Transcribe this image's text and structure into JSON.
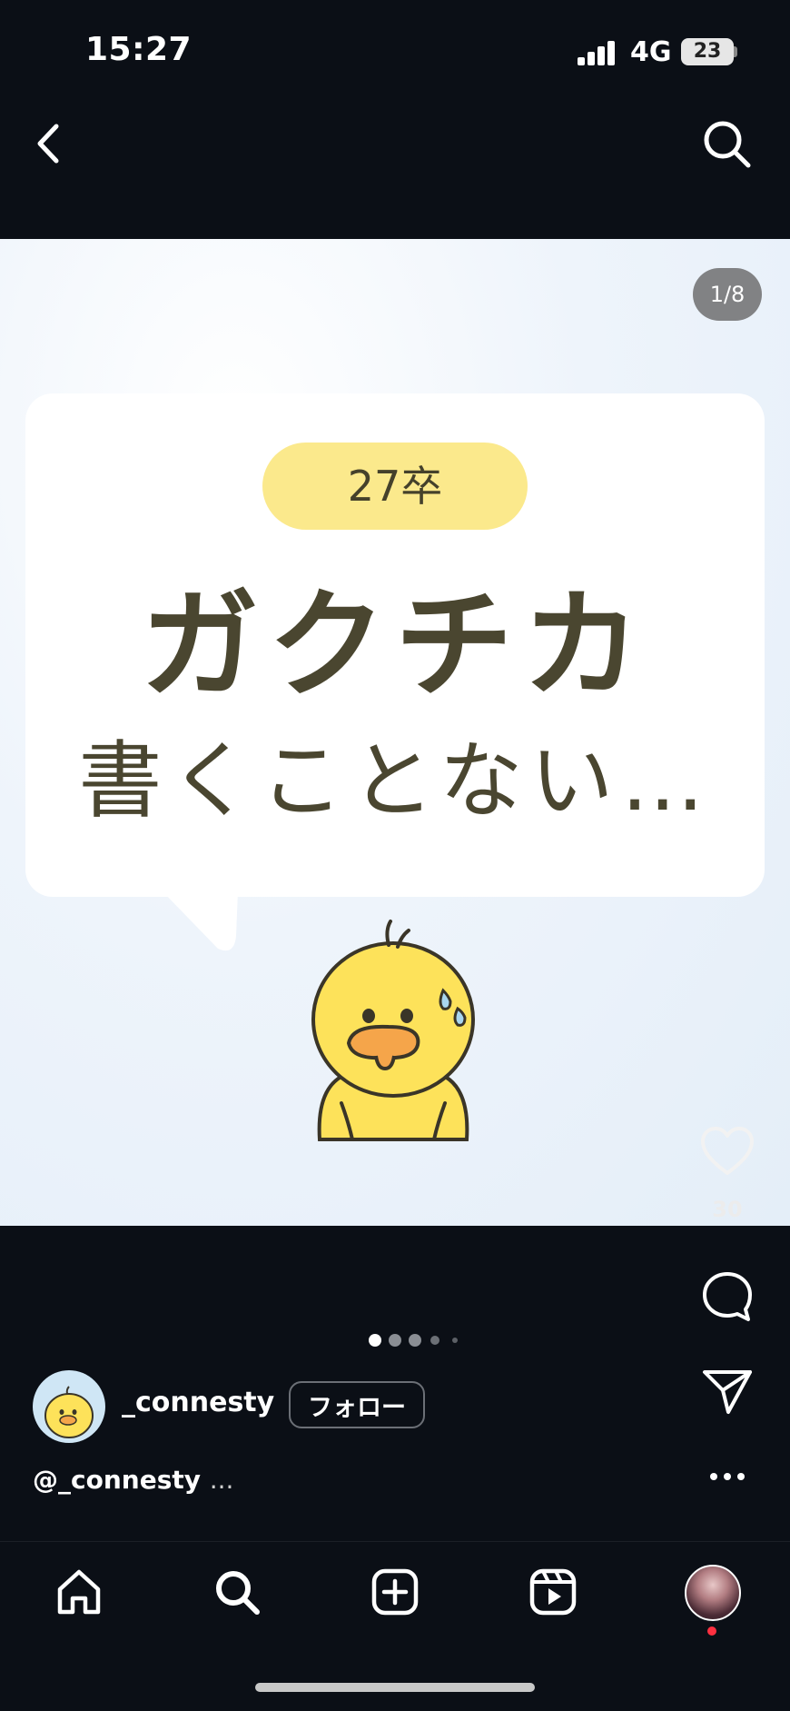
{
  "status_bar": {
    "time": "15:27",
    "network": "4G",
    "battery": "23"
  },
  "post": {
    "counter": "1/8",
    "badge_text": "27卒",
    "headline_line1": "ガクチカ",
    "headline_line2": "書くことない…"
  },
  "actions": {
    "like_count": "30"
  },
  "carousel": {
    "total_dots": 5,
    "active_index": 0
  },
  "author": {
    "username": "_connesty",
    "follow_label": "フォロー"
  },
  "caption": {
    "text": "@_connesty",
    "more": "..."
  },
  "colors": {
    "background": "#0b0f16",
    "badge": "#fbe98c",
    "headline": "#4a4630",
    "chick": "#fde25a",
    "notification": "#ff3040"
  },
  "icons": {
    "back": "chevron-left-icon",
    "search": "search-icon",
    "like": "heart-icon",
    "comment": "comment-icon",
    "share": "send-icon",
    "more": "more-horizontal-icon",
    "home": "home-icon",
    "explore": "search-icon",
    "create": "plus-square-icon",
    "reels": "reels-icon"
  }
}
